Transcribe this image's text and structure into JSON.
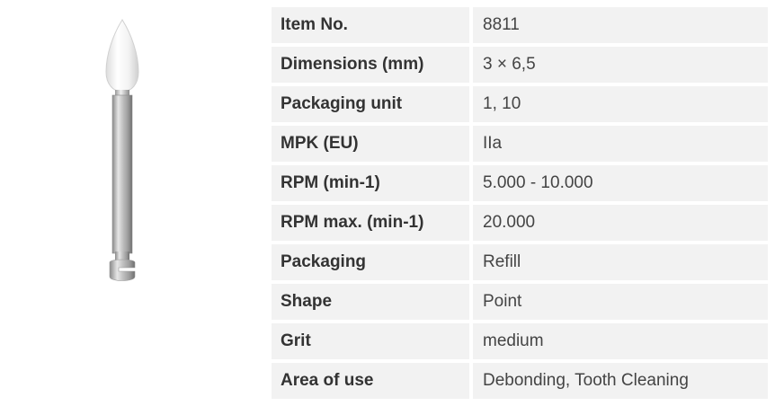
{
  "product": {
    "image_icon": "polishing-point-bur-image"
  },
  "specs": [
    {
      "label": "Item No.",
      "value": "8811"
    },
    {
      "label": "Dimensions (mm)",
      "value": "3 × 6,5"
    },
    {
      "label": "Packaging unit",
      "value": "1, 10"
    },
    {
      "label": "MPK (EU)",
      "value": "IIa"
    },
    {
      "label": "RPM (min-1)",
      "value": "5.000 - 10.000"
    },
    {
      "label": "RPM max. (min-1)",
      "value": "20.000"
    },
    {
      "label": "Packaging",
      "value": "Refill"
    },
    {
      "label": "Shape",
      "value": "Point"
    },
    {
      "label": "Grit",
      "value": "medium"
    },
    {
      "label": "Area of use",
      "value": "Debonding, Tooth Cleaning"
    }
  ]
}
